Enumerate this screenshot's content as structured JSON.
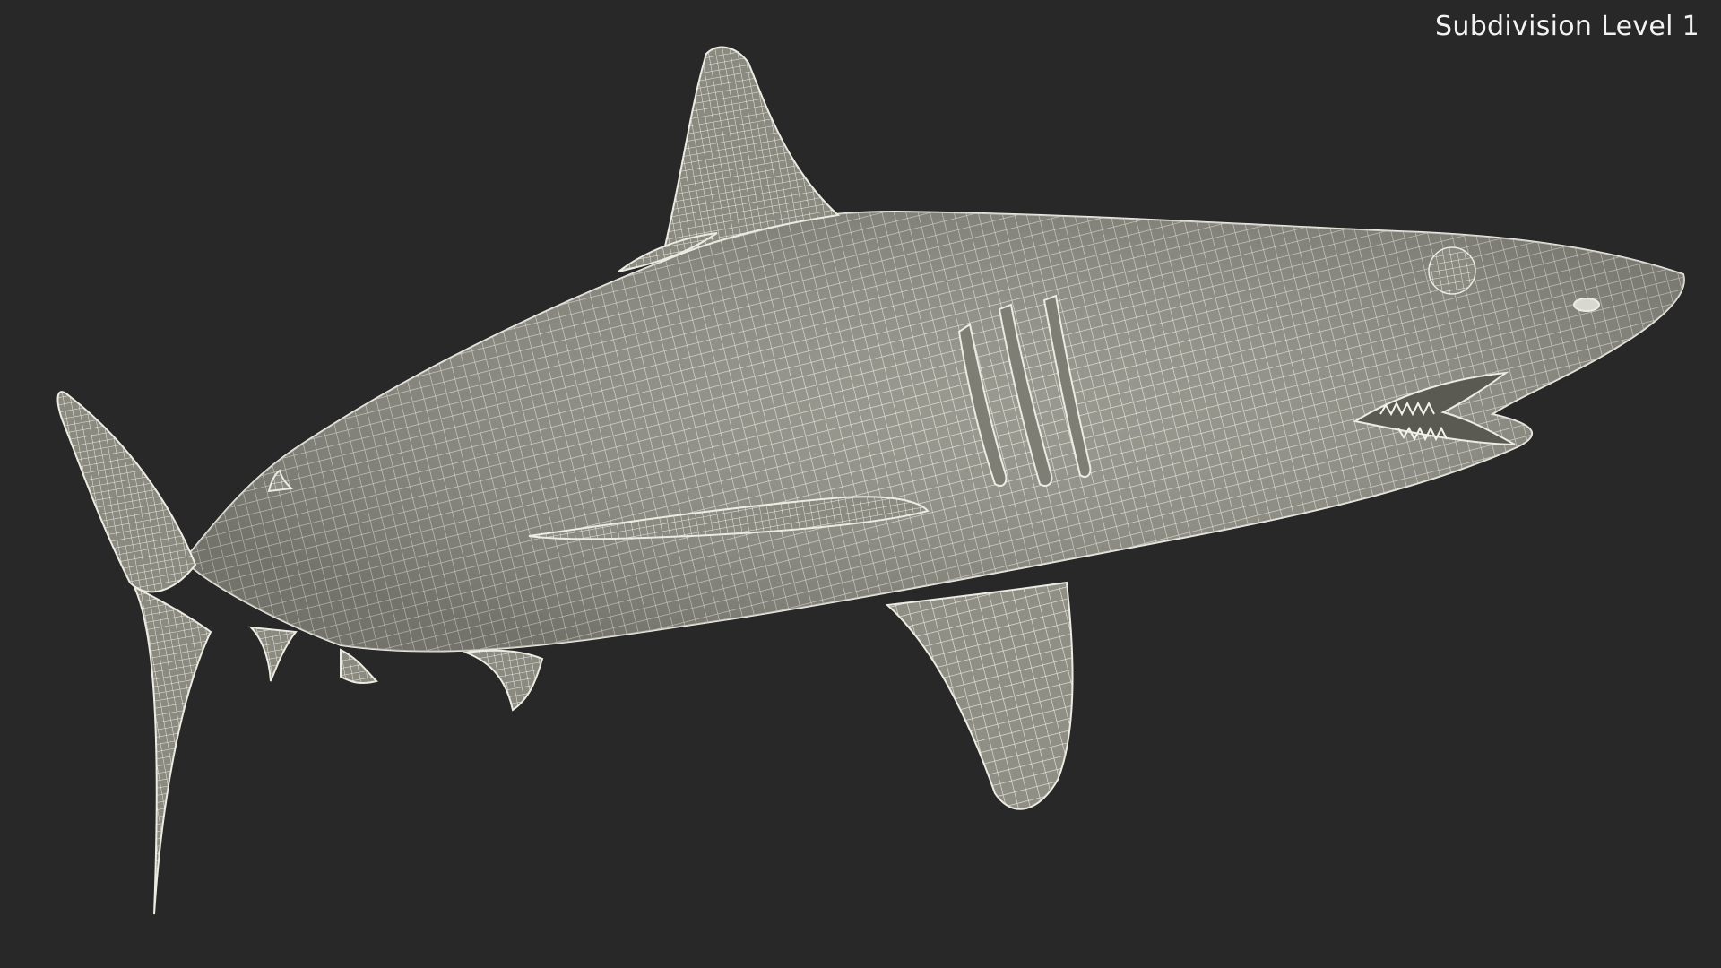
{
  "viewport": {
    "background": "#282828",
    "subdivision_label": "Subdivision Level 1"
  },
  "model": {
    "subject": "shark-wireframe",
    "surface_color": "#8f8f85",
    "wire_color": "#ecebe2",
    "shadow_color": "#6f6f66"
  }
}
